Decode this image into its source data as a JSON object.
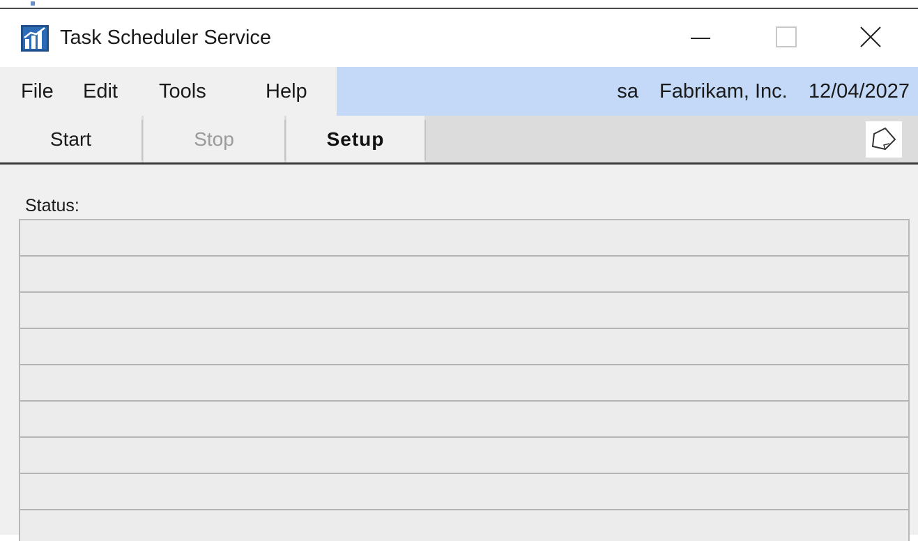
{
  "window": {
    "title": "Task Scheduler Service",
    "app_icon": "bar-chart-icon",
    "controls": [
      "minimize-icon",
      "maximize-icon",
      "close-icon"
    ]
  },
  "menubar": {
    "items": [
      {
        "label": "File"
      },
      {
        "label": "Edit"
      },
      {
        "label": "Tools"
      },
      {
        "label": "Help"
      }
    ],
    "user": "sa",
    "company": "Fabrikam, Inc.",
    "date": "12/04/2027",
    "info_bg_color": "#c3d9f7"
  },
  "toolbar": {
    "start_label": "Start",
    "stop_label": "Stop",
    "setup_label": "Setup",
    "note_icon": "note-icon"
  },
  "status": {
    "label": "Status:",
    "rows": [
      "",
      "",
      "",
      "",
      "",
      "",
      "",
      "",
      ""
    ]
  }
}
